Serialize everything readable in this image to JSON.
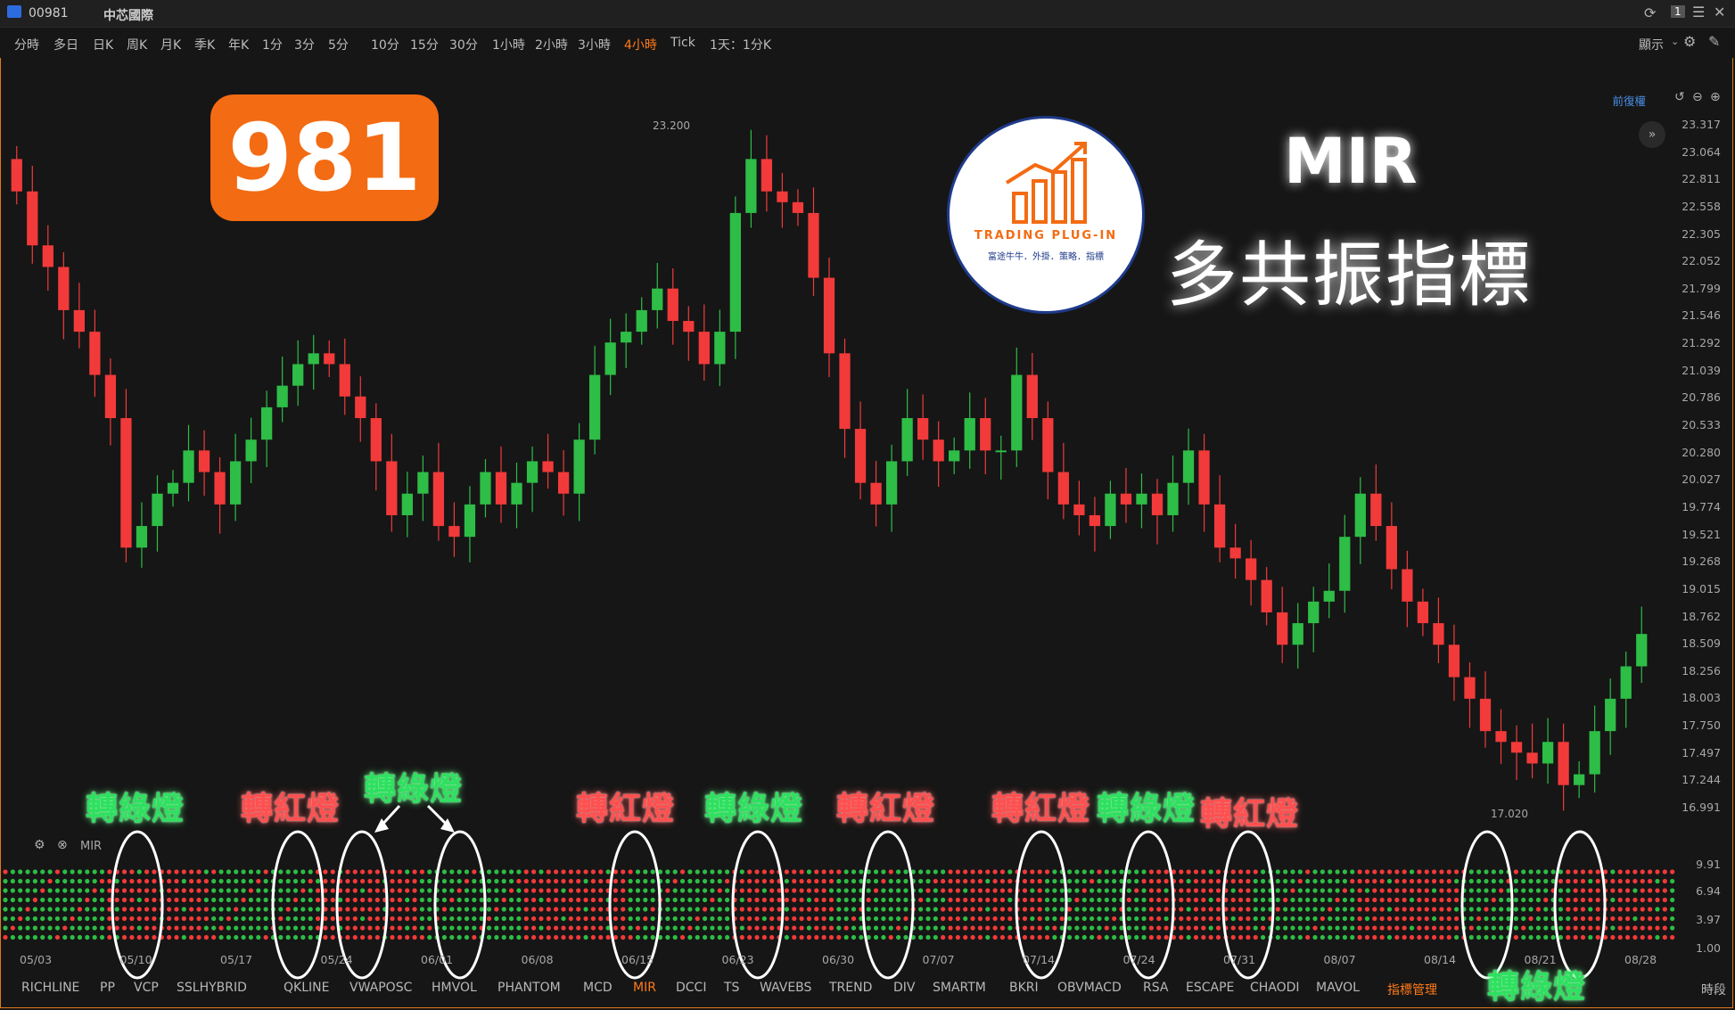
{
  "window": {
    "code": "00981",
    "name": "中芯國際"
  },
  "toolbar": {
    "timeframes": [
      "分時",
      "多日",
      "日K",
      "周K",
      "月K",
      "季K",
      "年K",
      "1分",
      "3分",
      "5分",
      "10分",
      "15分",
      "30分",
      "1小時",
      "2小時",
      "3小時",
      "4小時",
      "Tick",
      "1天：1分K"
    ],
    "active_timeframe": "4小時",
    "display_label": "顯示"
  },
  "chart_header": {
    "adjust_label": "前復權"
  },
  "price_axis": [
    "23.317",
    "23.064",
    "22.811",
    "22.558",
    "22.305",
    "22.052",
    "21.799",
    "21.546",
    "21.292",
    "21.039",
    "20.786",
    "20.533",
    "20.280",
    "20.027",
    "19.774",
    "19.521",
    "19.268",
    "19.015",
    "18.762",
    "18.509",
    "18.256",
    "18.003",
    "17.750",
    "17.497",
    "17.244",
    "16.991"
  ],
  "high_label": "23.200",
  "low_label": "17.020",
  "indicator_axis": [
    "9.91",
    "6.94",
    "3.97",
    "1.00"
  ],
  "indicator_name": "MIR",
  "date_axis": [
    "05/03",
    "05/10",
    "05/17",
    "05/24",
    "06/01",
    "06/08",
    "06/15",
    "06/23",
    "06/30",
    "07/07",
    "07/14",
    "07/24",
    "07/31",
    "08/07",
    "08/14",
    "08/21",
    "08/28"
  ],
  "indicators": [
    "RICHLINE",
    "PP",
    "VCP",
    "SSLHYBRID",
    "QKLINE",
    "VWAPOSC",
    "HMVOL",
    "PHANTOM",
    "MCD",
    "MIR",
    "DCCI",
    "TS",
    "WAVEBS",
    "TREND",
    "DIV",
    "SMARTM",
    "BKRI",
    "OBVMACD",
    "RSA",
    "ESCAPE",
    "CHAODI",
    "MAVOL",
    "指標管理"
  ],
  "active_indicator": "MIR",
  "section_label": "時段",
  "badge": "981",
  "logo": {
    "line1": "TRADING PLUG-IN",
    "line2": "富途牛牛．外掛．策略．指標"
  },
  "overlay_title": "MIR",
  "overlay_subtitle": "多共振指標",
  "signals": [
    {
      "text": "轉綠燈",
      "color": "green"
    },
    {
      "text": "轉紅燈",
      "color": "red"
    },
    {
      "text": "轉綠燈",
      "color": "green"
    },
    {
      "text": "轉紅燈",
      "color": "red"
    },
    {
      "text": "轉綠燈",
      "color": "green"
    },
    {
      "text": "轉紅燈",
      "color": "red"
    },
    {
      "text": "轉紅燈",
      "color": "red"
    },
    {
      "text": "轉綠燈",
      "color": "green"
    },
    {
      "text": "轉紅燈",
      "color": "red"
    },
    {
      "text": "轉綠燈",
      "color": "green"
    }
  ],
  "colors": {
    "up": "#2ebd46",
    "down": "#f23a3a",
    "accent": "#ff7a1a",
    "badge": "#f36b12"
  },
  "chart_data": {
    "type": "candlestick",
    "ylim": [
      16.991,
      23.317
    ],
    "high": 23.2,
    "low": 17.02,
    "closes": [
      22.7,
      22.2,
      22.0,
      21.6,
      21.4,
      21.0,
      20.6,
      19.4,
      19.6,
      19.9,
      20.0,
      20.3,
      20.1,
      19.8,
      20.2,
      20.4,
      20.7,
      20.9,
      21.1,
      21.2,
      21.1,
      20.8,
      20.6,
      20.2,
      19.7,
      19.9,
      20.1,
      19.6,
      19.5,
      19.8,
      20.1,
      19.8,
      20.0,
      20.2,
      20.1,
      19.9,
      20.4,
      21.0,
      21.3,
      21.4,
      21.6,
      21.8,
      21.5,
      21.4,
      21.1,
      21.4,
      22.5,
      23.0,
      22.7,
      22.6,
      22.5,
      21.9,
      21.2,
      20.5,
      20.0,
      19.8,
      20.2,
      20.6,
      20.4,
      20.2,
      20.3,
      20.6,
      20.3,
      20.3,
      21.0,
      20.6,
      20.1,
      19.8,
      19.7,
      19.6,
      19.9,
      19.8,
      19.9,
      19.7,
      20.0,
      20.3,
      19.8,
      19.4,
      19.3,
      19.1,
      18.8,
      18.5,
      18.7,
      18.9,
      19.0,
      19.5,
      19.9,
      19.6,
      19.2,
      18.9,
      18.7,
      18.5,
      18.2,
      18.0,
      17.7,
      17.6,
      17.5,
      17.4,
      17.6,
      17.2,
      17.3,
      17.7,
      18.0,
      18.3,
      18.6
    ]
  }
}
